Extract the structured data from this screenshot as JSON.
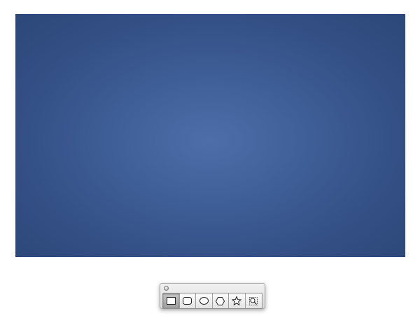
{
  "canvas": {
    "gradient_center_color": "#4d6ea8",
    "gradient_edge_color": "#2c4778"
  },
  "palette": {
    "close_icon": "close-icon",
    "tools": [
      {
        "icon": "rectangle-icon",
        "selected": true
      },
      {
        "icon": "rounded-rectangle-icon",
        "selected": false
      },
      {
        "icon": "oval-icon",
        "selected": false
      },
      {
        "icon": "polygon-icon",
        "selected": false
      },
      {
        "icon": "star-icon",
        "selected": false
      },
      {
        "icon": "custom-shape-icon",
        "selected": false
      }
    ]
  }
}
